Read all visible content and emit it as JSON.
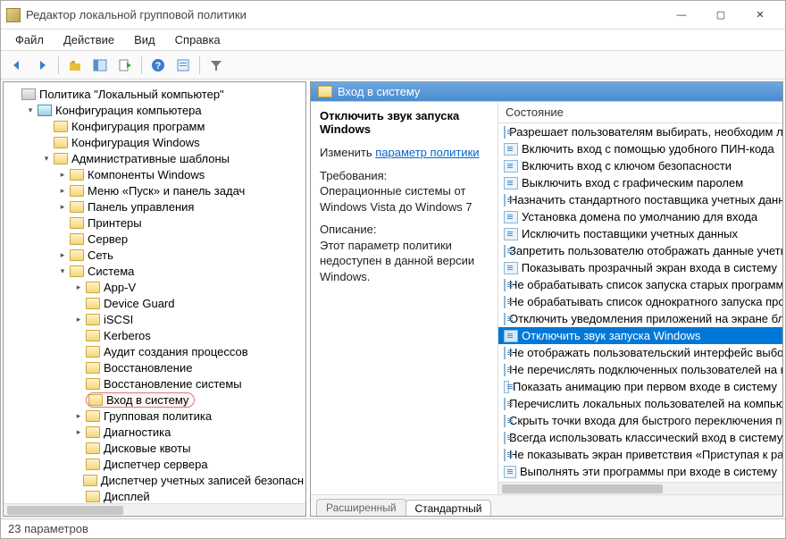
{
  "window": {
    "title": "Редактор локальной групповой политики"
  },
  "menubar": [
    "Файл",
    "Действие",
    "Вид",
    "Справка"
  ],
  "toolbar_icons": [
    "back",
    "forward",
    "up",
    "winframe",
    "export",
    "help",
    "properties",
    "filter"
  ],
  "tree": [
    {
      "label": "Политика \"Локальный компьютер\"",
      "depth": 0,
      "expander": "",
      "icon": "root"
    },
    {
      "label": "Конфигурация компьютера",
      "depth": 1,
      "expander": "▾",
      "icon": "computer"
    },
    {
      "label": "Конфигурация программ",
      "depth": 2,
      "expander": "",
      "icon": "folder"
    },
    {
      "label": "Конфигурация Windows",
      "depth": 2,
      "expander": "",
      "icon": "folder"
    },
    {
      "label": "Административные шаблоны",
      "depth": 2,
      "expander": "▾",
      "icon": "folder"
    },
    {
      "label": "Компоненты Windows",
      "depth": 3,
      "expander": "▸",
      "icon": "folder"
    },
    {
      "label": "Меню «Пуск» и панель задач",
      "depth": 3,
      "expander": "▸",
      "icon": "folder"
    },
    {
      "label": "Панель управления",
      "depth": 3,
      "expander": "▸",
      "icon": "folder"
    },
    {
      "label": "Принтеры",
      "depth": 3,
      "expander": "",
      "icon": "folder"
    },
    {
      "label": "Сервер",
      "depth": 3,
      "expander": "",
      "icon": "folder"
    },
    {
      "label": "Сеть",
      "depth": 3,
      "expander": "▸",
      "icon": "folder"
    },
    {
      "label": "Система",
      "depth": 3,
      "expander": "▾",
      "icon": "folder"
    },
    {
      "label": "App-V",
      "depth": 4,
      "expander": "▸",
      "icon": "folder"
    },
    {
      "label": "Device Guard",
      "depth": 4,
      "expander": "",
      "icon": "folder"
    },
    {
      "label": "iSCSI",
      "depth": 4,
      "expander": "▸",
      "icon": "folder"
    },
    {
      "label": "Kerberos",
      "depth": 4,
      "expander": "",
      "icon": "folder"
    },
    {
      "label": "Аудит создания процессов",
      "depth": 4,
      "expander": "",
      "icon": "folder"
    },
    {
      "label": "Восстановление",
      "depth": 4,
      "expander": "",
      "icon": "folder"
    },
    {
      "label": "Восстановление системы",
      "depth": 4,
      "expander": "",
      "icon": "folder"
    },
    {
      "label": "Вход в систему",
      "depth": 4,
      "expander": "",
      "icon": "folder",
      "highlight": true
    },
    {
      "label": "Групповая политика",
      "depth": 4,
      "expander": "▸",
      "icon": "folder"
    },
    {
      "label": "Диагностика",
      "depth": 4,
      "expander": "▸",
      "icon": "folder"
    },
    {
      "label": "Дисковые квоты",
      "depth": 4,
      "expander": "",
      "icon": "folder"
    },
    {
      "label": "Диспетчер сервера",
      "depth": 4,
      "expander": "",
      "icon": "folder"
    },
    {
      "label": "Диспетчер учетных записей безопасн",
      "depth": 4,
      "expander": "",
      "icon": "folder"
    },
    {
      "label": "Дисплей",
      "depth": 4,
      "expander": "",
      "icon": "folder"
    }
  ],
  "right": {
    "header": "Вход в систему",
    "selected_policy_title": "Отключить звук запуска Windows",
    "edit_label": "Изменить",
    "edit_link": "параметр политики",
    "requirements_heading": "Требования:",
    "requirements_text": "Операционные системы от Windows Vista до Windows 7",
    "description_heading": "Описание:",
    "description_text": "Этот параметр политики недоступен в данной версии Windows.",
    "column_header": "Состояние",
    "policies": [
      {
        "label": "Разрешает пользователям выбирать, необходим ли в",
        "selected": false
      },
      {
        "label": "Включить вход с помощью удобного ПИН-кода",
        "selected": false
      },
      {
        "label": "Включить вход с ключом безопасности",
        "selected": false
      },
      {
        "label": "Выключить вход с графическим паролем",
        "selected": false
      },
      {
        "label": "Назначить стандартного поставщика учетных данн",
        "selected": false
      },
      {
        "label": "Установка домена по умолчанию для входа",
        "selected": false
      },
      {
        "label": "Исключить поставщики учетных данных",
        "selected": false
      },
      {
        "label": "Запретить пользователю отображать данные учетно",
        "selected": false
      },
      {
        "label": "Показывать прозрачный экран входа в систему",
        "selected": false
      },
      {
        "label": "Не обрабатывать список запуска старых программ",
        "selected": false
      },
      {
        "label": "Не обрабатывать список однократного запуска про",
        "selected": false
      },
      {
        "label": "Отключить уведомления приложений на экране бл",
        "selected": false
      },
      {
        "label": "Отключить звук запуска Windows",
        "selected": true
      },
      {
        "label": "Не отображать пользовательский интерфейс выбор",
        "selected": false
      },
      {
        "label": "Не перечислять подключенных пользователей на ко",
        "selected": false
      },
      {
        "label": "Показать анимацию при первом входе в систему",
        "selected": false
      },
      {
        "label": "Перечислить локальных пользователей на компьют",
        "selected": false
      },
      {
        "label": "Скрыть точки входа для быстрого переключения по",
        "selected": false
      },
      {
        "label": "Всегда использовать классический вход в систему",
        "selected": false
      },
      {
        "label": "Не показывать экран приветствия «Приступая к раб",
        "selected": false
      },
      {
        "label": "Выполнять эти программы при входе в систему",
        "selected": false
      }
    ]
  },
  "tabs": [
    {
      "label": "Расширенный",
      "active": false
    },
    {
      "label": "Стандартный",
      "active": true
    }
  ],
  "statusbar": "23 параметров"
}
